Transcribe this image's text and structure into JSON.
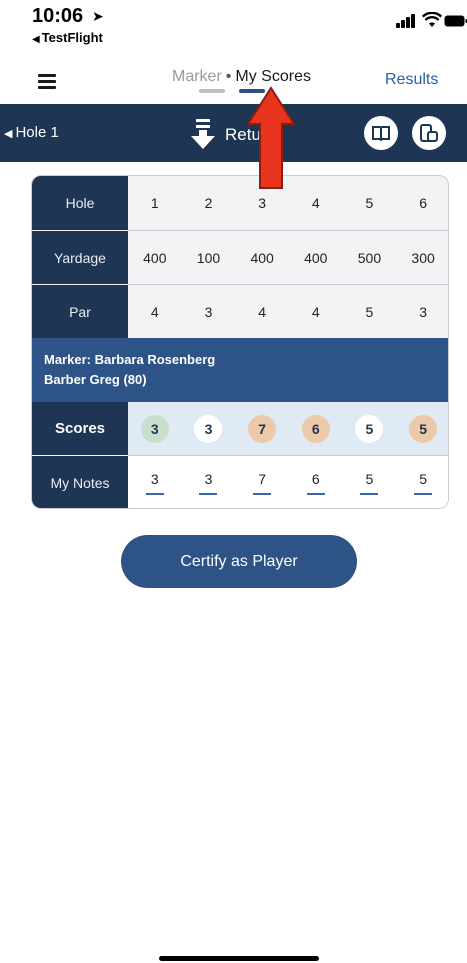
{
  "status_bar": {
    "time": "10:06",
    "back_app": "TestFlight"
  },
  "nav": {
    "tab_marker": "Marker",
    "separator": "•",
    "tab_my_scores": "My Scores",
    "results": "Results",
    "active_tab": "My Scores"
  },
  "hole_bar": {
    "back_label": "Hole 1",
    "return_label": "Return"
  },
  "scorecard": {
    "hole_label": "Hole",
    "yardage_label": "Yardage",
    "par_label": "Par",
    "scores_label": "Scores",
    "notes_label": "My Notes",
    "holes": [
      "1",
      "2",
      "3",
      "4",
      "5",
      "6"
    ],
    "yardage": [
      "400",
      "100",
      "400",
      "400",
      "500",
      "300"
    ],
    "par": [
      "4",
      "3",
      "4",
      "4",
      "5",
      "3"
    ],
    "marker_line": "Marker: Barbara Rosenberg",
    "player_line": "Barber Greg (80)",
    "scores": [
      "3",
      "3",
      "7",
      "6",
      "5",
      "5"
    ],
    "score_styles": [
      "green",
      "white",
      "tan",
      "tan",
      "white",
      "tan"
    ],
    "notes": [
      "3",
      "3",
      "7",
      "6",
      "5",
      "5"
    ]
  },
  "certify_button": "Certify as Player",
  "colors": {
    "navy": "#1e3553",
    "accent_blue": "#2d5387",
    "link_blue": "#2a5fa6",
    "birdie_green": "#c8e0cb",
    "bogey_tan": "#ecc9a8",
    "annotation_red": "#e8341c"
  }
}
